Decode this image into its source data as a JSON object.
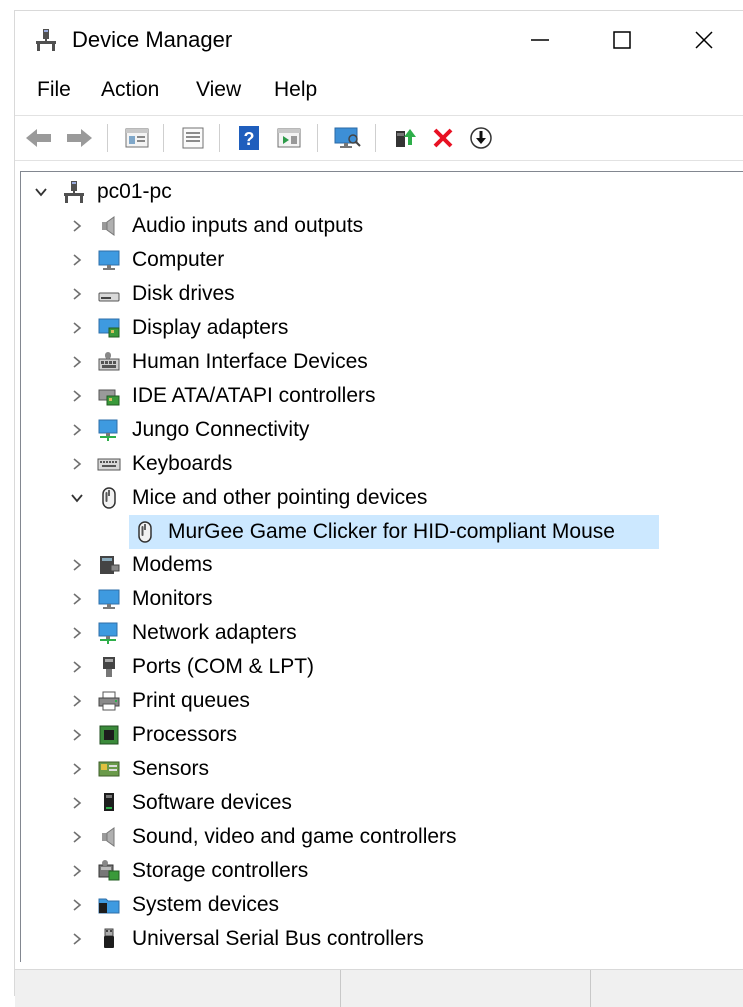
{
  "window": {
    "title": "Device Manager",
    "minimize": "—",
    "maximize": "☐",
    "close": "✕"
  },
  "menu": [
    "File",
    "Action",
    "View",
    "Help"
  ],
  "toolbar": {
    "buttons": [
      "back-icon",
      "forward-icon",
      "properties-icon",
      "show-hidden-icon",
      "help-icon",
      "action-pane-icon",
      "scan-hardware-icon",
      "update-driver-icon",
      "uninstall-icon",
      "disable-icon"
    ]
  },
  "tree": {
    "root": {
      "label": "pc01-pc",
      "icon": "computer-root-icon",
      "expanded": true
    },
    "categories": [
      {
        "label": "Audio inputs and outputs",
        "icon": "speaker-icon"
      },
      {
        "label": "Computer",
        "icon": "monitor-icon"
      },
      {
        "label": "Disk drives",
        "icon": "disk-icon"
      },
      {
        "label": "Display adapters",
        "icon": "display-adapter-icon"
      },
      {
        "label": "Human Interface Devices",
        "icon": "hid-icon"
      },
      {
        "label": "IDE ATA/ATAPI controllers",
        "icon": "ide-icon"
      },
      {
        "label": "Jungo Connectivity",
        "icon": "network-icon"
      },
      {
        "label": "Keyboards",
        "icon": "keyboard-icon"
      },
      {
        "label": "Mice and other pointing devices",
        "icon": "mouse-icon",
        "expanded": true,
        "children": [
          {
            "label": "MurGee Game Clicker for HID-compliant Mouse",
            "icon": "mouse-icon",
            "selected": true
          }
        ]
      },
      {
        "label": "Modems",
        "icon": "modem-icon"
      },
      {
        "label": "Monitors",
        "icon": "monitor-icon"
      },
      {
        "label": "Network adapters",
        "icon": "network-icon"
      },
      {
        "label": "Ports (COM & LPT)",
        "icon": "port-icon"
      },
      {
        "label": "Print queues",
        "icon": "printer-icon"
      },
      {
        "label": "Processors",
        "icon": "processor-icon"
      },
      {
        "label": "Sensors",
        "icon": "sensor-icon"
      },
      {
        "label": "Software devices",
        "icon": "software-device-icon"
      },
      {
        "label": "Sound, video and game controllers",
        "icon": "speaker-icon"
      },
      {
        "label": "Storage controllers",
        "icon": "storage-icon"
      },
      {
        "label": "System devices",
        "icon": "system-folder-icon"
      },
      {
        "label": "Universal Serial Bus controllers",
        "icon": "usb-icon"
      }
    ]
  },
  "colors": {
    "selection": "#cce8ff",
    "accent": "#0078d7",
    "uninstall": "#e81123"
  }
}
